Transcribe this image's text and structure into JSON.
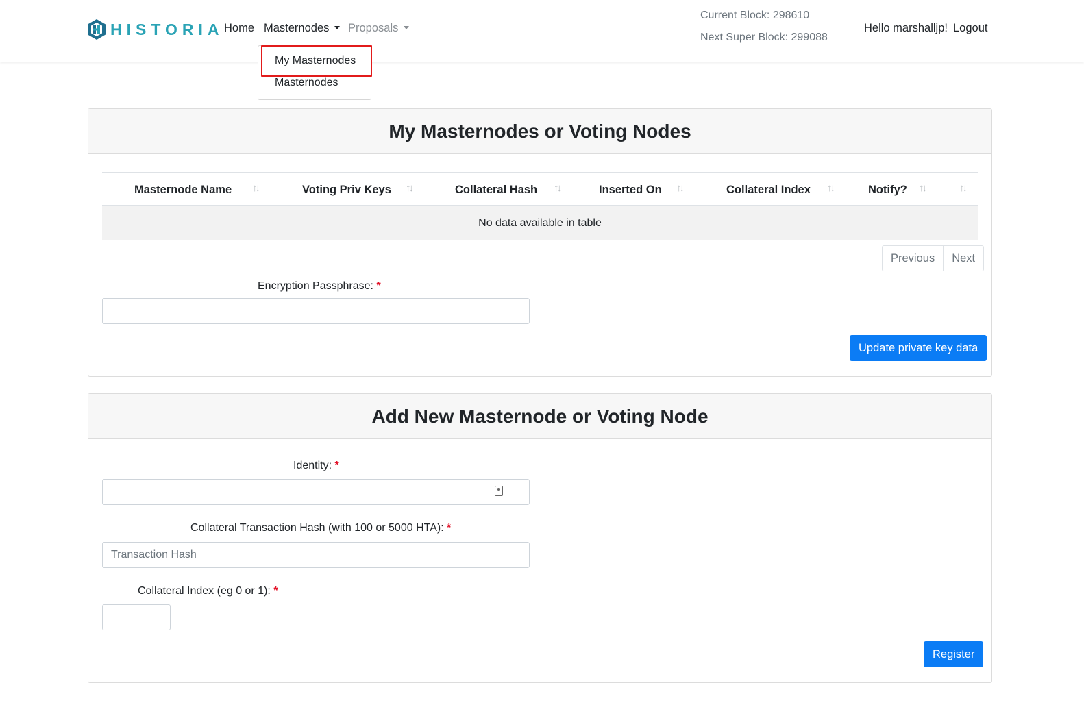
{
  "brand": {
    "name": "HISTORIA",
    "color": "#2aa3b5"
  },
  "nav": {
    "home": "Home",
    "masternodes": "Masternodes",
    "proposals": "Proposals",
    "current_block": "Current Block: 298610",
    "next_super_block": "Next Super Block: 299088",
    "greeting": "Hello marshalljp!",
    "logout": "Logout"
  },
  "dropdown": {
    "items": [
      "My Masternodes",
      "Masternodes"
    ],
    "highlighted": "My Masternodes"
  },
  "my_nodes": {
    "title": "My Masternodes or Voting Nodes",
    "columns": [
      "Masternode Name",
      "Voting Priv Keys",
      "Collateral Hash",
      "Inserted On",
      "Collateral Index",
      "Notify?",
      ""
    ],
    "empty_message": "No data available in table",
    "pager": {
      "previous": "Previous",
      "next": "Next"
    },
    "passphrase_label": "Encryption Passphrase:",
    "required_mark": "*",
    "passphrase_value": "",
    "update_button": "Update private key data"
  },
  "add_node": {
    "title": "Add New Masternode or Voting Node",
    "identity_label": "Identity:",
    "identity_value": "",
    "hash_label": "Collateral Transaction Hash (with 100 or 5000 HTA):",
    "hash_placeholder": "Transaction Hash",
    "index_label": "Collateral Index (eg 0 or 1):",
    "index_value": "",
    "register_button": "Register"
  },
  "colors": {
    "primary": "#0b7cf5",
    "required": "#e3142a",
    "highlight": "#e21b1b"
  }
}
